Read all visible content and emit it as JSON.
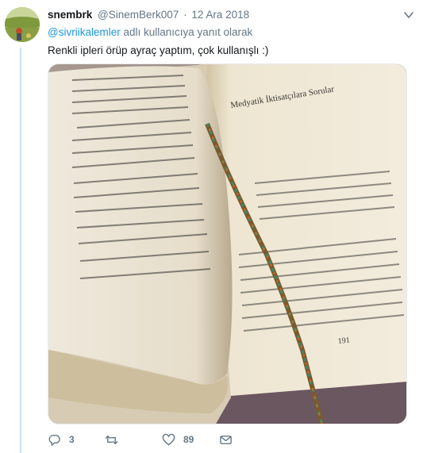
{
  "tweet": {
    "author": {
      "display_name": "snembrk",
      "handle": "@SinemBerk007",
      "avatar_icon": "profile-photo"
    },
    "separator": "·",
    "date": "12 Ara 2018",
    "reply_to": {
      "mention": "@sivriikalemler",
      "suffix": " adlı kullanıcıya yanıt olarak"
    },
    "text": "Renkli ipleri örüp ayraç yaptım, çok kullanışlı :)",
    "media": {
      "kind": "photo",
      "book_page_header": "Medyatik İktisatçılara Sorular",
      "page_number": "191"
    },
    "actions": {
      "reply": {
        "icon": "reply-icon",
        "count": "3"
      },
      "retweet": {
        "icon": "retweet-icon",
        "count": ""
      },
      "like": {
        "icon": "heart-icon",
        "count": "89"
      },
      "dm": {
        "icon": "envelope-icon"
      }
    }
  },
  "colors": {
    "link": "#1b95e0",
    "muted": "#657786",
    "text": "#14171a",
    "thread_line": "#cfe1ef"
  }
}
